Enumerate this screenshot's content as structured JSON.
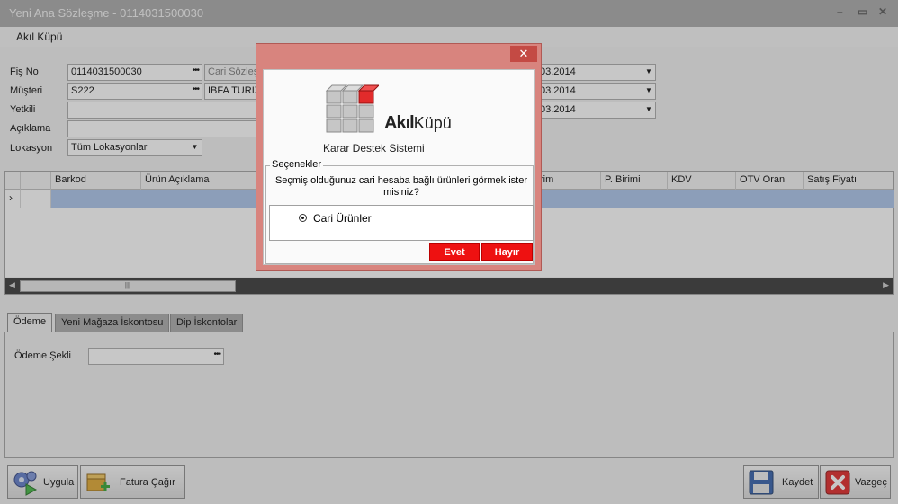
{
  "window": {
    "title": "Yeni Ana Sözleşme - 0114031500030",
    "minimize": "–",
    "restore": "▭",
    "close": "✕"
  },
  "menu": {
    "item": "Akıl Küpü"
  },
  "form": {
    "fis_no_label": "Fiş No",
    "fis_no_value": "0114031500030",
    "cari_sozlesme_placeholder": "Cari Sözleşme",
    "musteri_label": "Müşteri",
    "musteri_value": "S222",
    "musteri_name": "IBFA TURIZ",
    "yetkili_label": "Yetkili",
    "aciklama_label": "Açıklama",
    "lokasyon_label": "Lokasyon",
    "lokasyon_value": "Tüm Lokasyonlar",
    "date1": "03.2014",
    "date2": "03.2014",
    "date3": "03.2014"
  },
  "grid": {
    "columns": [
      "Barkod",
      "Ürün Açıklama",
      "rim",
      "P. Birimi",
      "KDV",
      "OTV Oran",
      "Satış Fiyatı"
    ],
    "row_indicator": "›"
  },
  "tabs": [
    "Ödeme",
    "Yeni Mağaza İskontosu",
    "Dip İskontolar"
  ],
  "payment": {
    "label": "Ödeme Şekli"
  },
  "buttons": {
    "apply": "Uygula",
    "invoice": "Fatura Çağır",
    "save": "Kaydet",
    "cancel": "Vazgeç"
  },
  "dialog": {
    "close": "✕",
    "brand_bold": "Akıl",
    "brand_light": "Küpü",
    "subtitle": "Karar Destek Sistemi",
    "group_title": "Seçenekler",
    "question": "Seçmiş olduğunuz cari hesaba bağlı ürünleri görmek ister misiniz?",
    "option": "Cari Ürünler",
    "yes": "Evet",
    "no": "Hayır"
  }
}
